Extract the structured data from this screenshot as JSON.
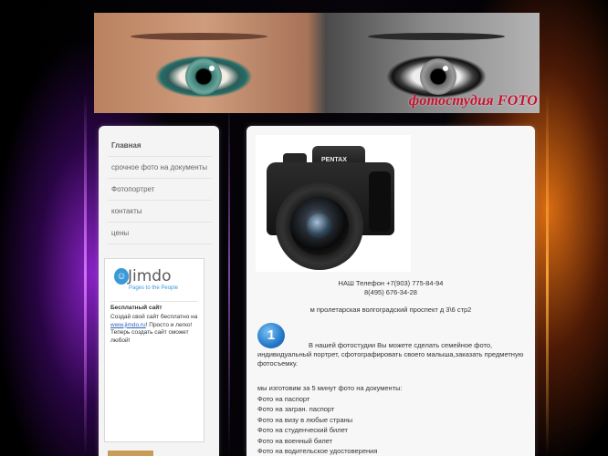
{
  "header": {
    "title": "фотостудия FOTO"
  },
  "sidebar": {
    "nav": [
      {
        "label": "Главная",
        "active": true
      },
      {
        "label": "срочное фото на документы"
      },
      {
        "label": "Фотопортрет"
      },
      {
        "label": "контакты"
      },
      {
        "label": "цены"
      }
    ],
    "jimdo": {
      "logo": "Jimdo",
      "tagline": "Pages to the People",
      "title": "Бесплатный сайт",
      "text_before": "Создай свой сайт бесплатно на",
      "link": "www.jimdo.ru",
      "text_after": "! Просто и легко! Теперь создать сайт сможет любой!"
    }
  },
  "content": {
    "camera_brand": "PENTAX",
    "phone_line1": "НАШ Телефон +7(903) 775-84-94",
    "phone_line2": "8(495) 676-34-28",
    "address": "м пролетарская волгоградский проспект д 3\\6 стр2",
    "badge": "1",
    "intro_first": "В нашей фотостудии Вы можете сделать семейное фото,",
    "intro_rest": "индивидуальный портрет, сфотографировать своего малыша,заказать предметную фотосъемку.",
    "lead": "мы изготовим за 5 минут фото на документы:",
    "documents": [
      "Фото на паспорт",
      "Фото на загран. паспорт",
      "Фото на визу в любые страны",
      "Фото на студенческий билет",
      "Фото на военный билет",
      "Фото на водительское удостоверения"
    ]
  }
}
